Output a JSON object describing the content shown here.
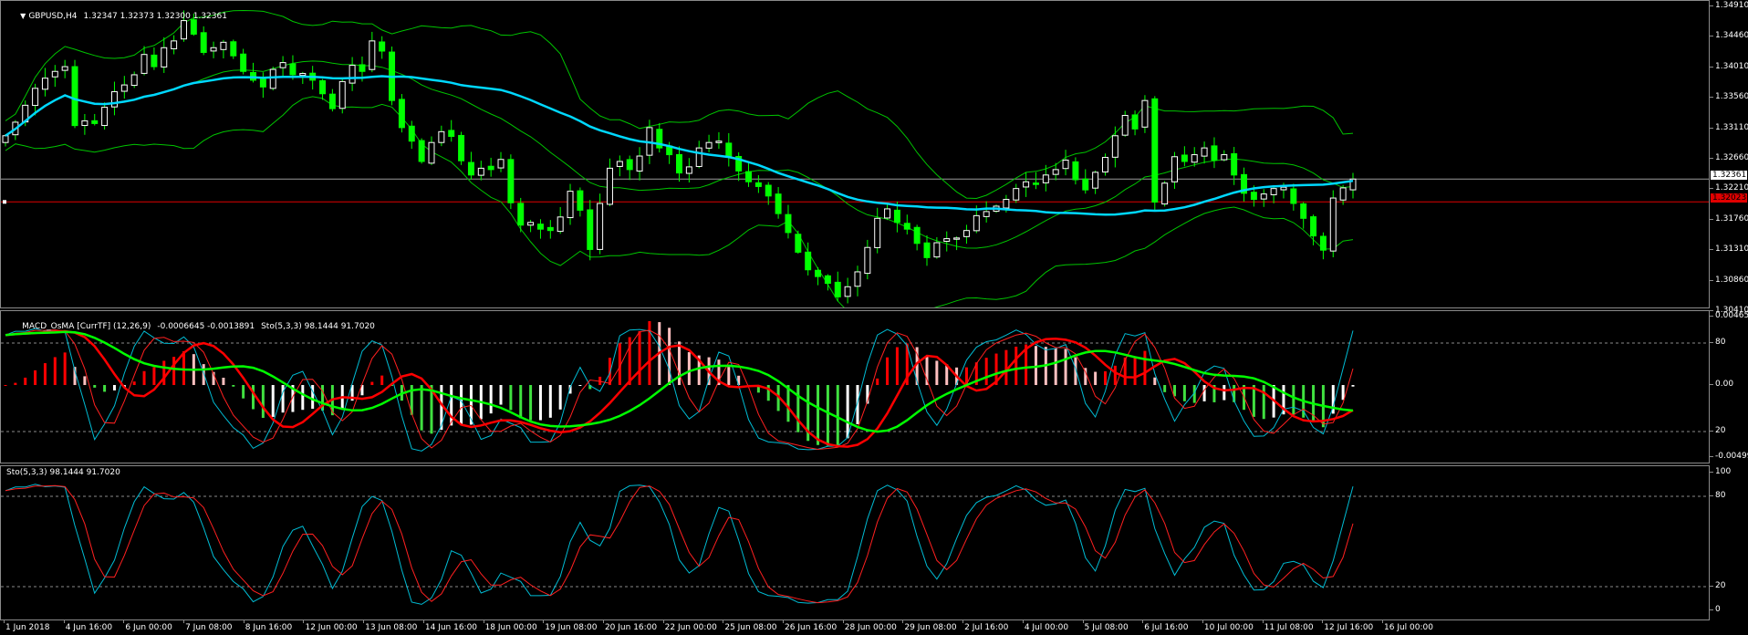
{
  "main": {
    "symbol": "GBPUSD,H4",
    "ohlc": "1.32347 1.32373 1.32300 1.32361",
    "price_scale": [
      "1.34910",
      "1.34460",
      "1.34010",
      "1.33560",
      "1.33110",
      "1.32660",
      "1.32210",
      "1.31760",
      "1.31310",
      "1.30860",
      "1.30410"
    ],
    "bid_tag": "1.32361",
    "alert_tag": "1.32023",
    "colors": {
      "background": "#000000",
      "bull_candle": "#ffffff",
      "bear_candle": "#00ff00",
      "ma_line": "#00d8ff",
      "bands": "#00c400",
      "alert_line": "#e00000"
    }
  },
  "macd": {
    "label_name": "MACD_OsMA [CurrTF] (12,26,9)",
    "label_values": "-0.0006645 -0.0013891",
    "label_sto": "Sto(5,3,3) 98.1444 91.7020",
    "scale_top": "0.004650",
    "scale_bottom": "-0.004992",
    "level_80": "80",
    "level_0": "0.00",
    "level_20": "20",
    "colors": {
      "hist_up": "#ff0000",
      "hist_up_light": "#ffc0c0",
      "hist_down": "#40e040",
      "hist_down_light": "#ffffff",
      "sto_main": "#00bcd4",
      "sto_signal": "#ff2020",
      "slow_line": "#00ff00",
      "fast_line": "#ff0000"
    }
  },
  "sto": {
    "label": "Sto(5,3,3) 98.1444 91.7020",
    "level_100": "100",
    "level_80": "80",
    "level_20": "20",
    "level_0": "0",
    "colors": {
      "main": "#00bcd4",
      "signal": "#ff2020"
    }
  },
  "time_axis": [
    "1 Jun 2018",
    "4 Jun 16:00",
    "6 Jun 00:00",
    "7 Jun 08:00",
    "8 Jun 16:00",
    "12 Jun 00:00",
    "13 Jun 08:00",
    "14 Jun 16:00",
    "18 Jun 00:00",
    "19 Jun 08:00",
    "20 Jun 16:00",
    "22 Jun 00:00",
    "25 Jun 08:00",
    "26 Jun 16:00",
    "28 Jun 00:00",
    "29 Jun 08:00",
    "2 Jul 16:00",
    "4 Jul 00:00",
    "5 Jul 08:00",
    "6 Jul 16:00",
    "10 Jul 00:00",
    "11 Jul 08:00",
    "12 Jul 16:00",
    "16 Jul 00:00"
  ],
  "series": {
    "close": [
      1.33,
      1.332,
      1.3345,
      1.337,
      1.3385,
      1.3395,
      1.3402,
      1.3315,
      1.3322,
      1.3318,
      1.3342,
      1.3365,
      1.3375,
      1.339,
      1.342,
      1.3402,
      1.343,
      1.344,
      1.347,
      1.345,
      1.3423,
      1.343,
      1.3438,
      1.3418,
      1.3395,
      1.3382,
      1.3372,
      1.3398,
      1.3408,
      1.339,
      1.3392,
      1.3382,
      1.3362,
      1.334,
      1.338,
      1.3404,
      1.3395,
      1.344,
      1.3425,
      1.3352,
      1.3312,
      1.3292,
      1.3262,
      1.329,
      1.3306,
      1.3299,
      1.3263,
      1.3242,
      1.3252,
      1.325,
      1.3265,
      1.3201,
      1.3168,
      1.3172,
      1.3162,
      1.316,
      1.318,
      1.3218,
      1.319,
      1.3132,
      1.32,
      1.3252,
      1.3262,
      1.325,
      1.327,
      1.3312,
      1.3282,
      1.3272,
      1.3245,
      1.3254,
      1.3282,
      1.329,
      1.3292,
      1.3268,
      1.3248,
      1.3232,
      1.3225,
      1.3211,
      1.3185,
      1.3157,
      1.3128,
      1.3102,
      1.3092,
      1.3082,
      1.3062,
      1.3077,
      1.3099,
      1.3135,
      1.3178,
      1.3192,
      1.3172,
      1.3162,
      1.3141,
      1.312,
      1.3142,
      1.3148,
      1.3149,
      1.316,
      1.3182,
      1.3188,
      1.3196,
      1.3206,
      1.3222,
      1.3232,
      1.3228,
      1.3242,
      1.325,
      1.3264,
      1.3235,
      1.322,
      1.3246,
      1.3268,
      1.33,
      1.333,
      1.331,
      1.3352,
      1.3202,
      1.323,
      1.3269,
      1.3262,
      1.3272,
      1.3282,
      1.3264,
      1.3272,
      1.3242,
      1.3215,
      1.3206,
      1.3214,
      1.3222,
      1.3224,
      1.32,
      1.3178,
      1.3152,
      1.3131,
      1.3208,
      1.3223,
      1.3236
    ]
  }
}
